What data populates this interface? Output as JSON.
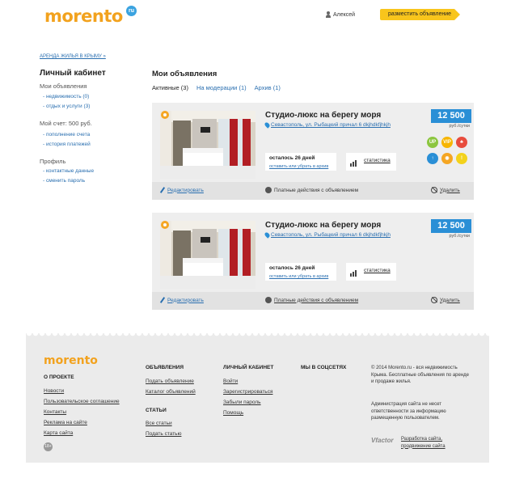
{
  "header": {
    "logo_text": "morento",
    "logo_badge": "ru",
    "user_name": "Алексей",
    "post_button": "разместить объявление"
  },
  "sidebar": {
    "breadcrumb": "АРЕНДА ЖИЛЬЯ В КРЫМУ »",
    "title": "Личный кабинет",
    "my_ads_heading": "Мои объявления",
    "my_ads_items": [
      "- недвижимость (0)",
      "- отдых и услуги (3)"
    ],
    "account_heading": "Мой счет: 500 руб.",
    "account_items": [
      "- пополнение счета",
      "- история платежей"
    ],
    "profile_heading": "Профиль",
    "profile_items": [
      "- контактные данные",
      "- сменить пароль"
    ]
  },
  "main": {
    "title": "Мои объявления",
    "tabs": [
      {
        "label": "Активные",
        "count": "(3)"
      },
      {
        "label": "На модерации",
        "count": "(1)"
      },
      {
        "label": "Архив",
        "count": "(1)"
      }
    ],
    "listings": [
      {
        "title": "Студио-люкс на берегу моря",
        "address": "Севастополь, ул. Рыбацкий причал 6 dkjhdkfjhkjh",
        "price": "12 500",
        "price_unit": "руб./сутки",
        "days_left": "осталось 26 дней",
        "days_link": "оставить или убрать в архив",
        "stats_label": "статистика",
        "edit_label": "Редактировать",
        "paid_label": "Платные действия с объявлением",
        "delete_label": "Удалить",
        "service_icons": [
          {
            "name": "up-icon",
            "text": "UP",
            "color": "#8cc63f"
          },
          {
            "name": "vip-icon",
            "text": "VIP",
            "color": "#f7b500"
          },
          {
            "name": "fire-icon",
            "text": "♣",
            "color": "#e84c3d"
          },
          {
            "name": "arrow-up-icon",
            "text": "↑",
            "color": "#2a8fd6"
          },
          {
            "name": "eye-icon",
            "text": "◉",
            "color": "#f5a623"
          },
          {
            "name": "exclamation-icon",
            "text": "!",
            "color": "#f3d21b"
          }
        ]
      },
      {
        "title": "Студио-люкс на берегу моря",
        "address": "Севастополь, ул. Рыбацкий причал 6 dkjhdkfjhkjh",
        "price": "12 500",
        "price_unit": "руб./сутки",
        "days_left": "осталось 26 дней",
        "days_link": "оставить или убрать в архив",
        "stats_label": "статистика",
        "edit_label": "Редактировать",
        "paid_label": "Платные действия с объявлением",
        "delete_label": "Удалить"
      }
    ]
  },
  "footer": {
    "logo_text": "morento",
    "about_heading": "О ПРОЕКТЕ",
    "about_links": [
      "Новости",
      "Пользовательское соглашение",
      "Контакты",
      "Реклама на сайте",
      "Карта сайта"
    ],
    "ads_heading": "ОБЪЯВЛЕНИЯ",
    "ads_links": [
      "Подать объявление",
      "Каталог объявлений"
    ],
    "articles_heading": "СТАТЬИ",
    "articles_links": [
      "Все статьи",
      "Подать статью"
    ],
    "cabinet_heading": "ЛИЧНЫЙ КАБИНЕТ",
    "cabinet_links": [
      "Войти",
      "Зарегистрироваться",
      "Забыли пароль",
      "Помощь"
    ],
    "social_heading": "МЫ В СОЦСЕТЯХ",
    "copyright": "© 2014 Morento.ru - вся недвижимость Крыма. Бесплатные объявления по аренде и продаже жилья.",
    "disclaimer": "Администрация сайта не несет ответственности за информацию размещенную пользователем.",
    "dev_logo": "Vfactor",
    "dev_text": "Разработка сайта, продвижение сайта",
    "age_badge": "18+"
  }
}
